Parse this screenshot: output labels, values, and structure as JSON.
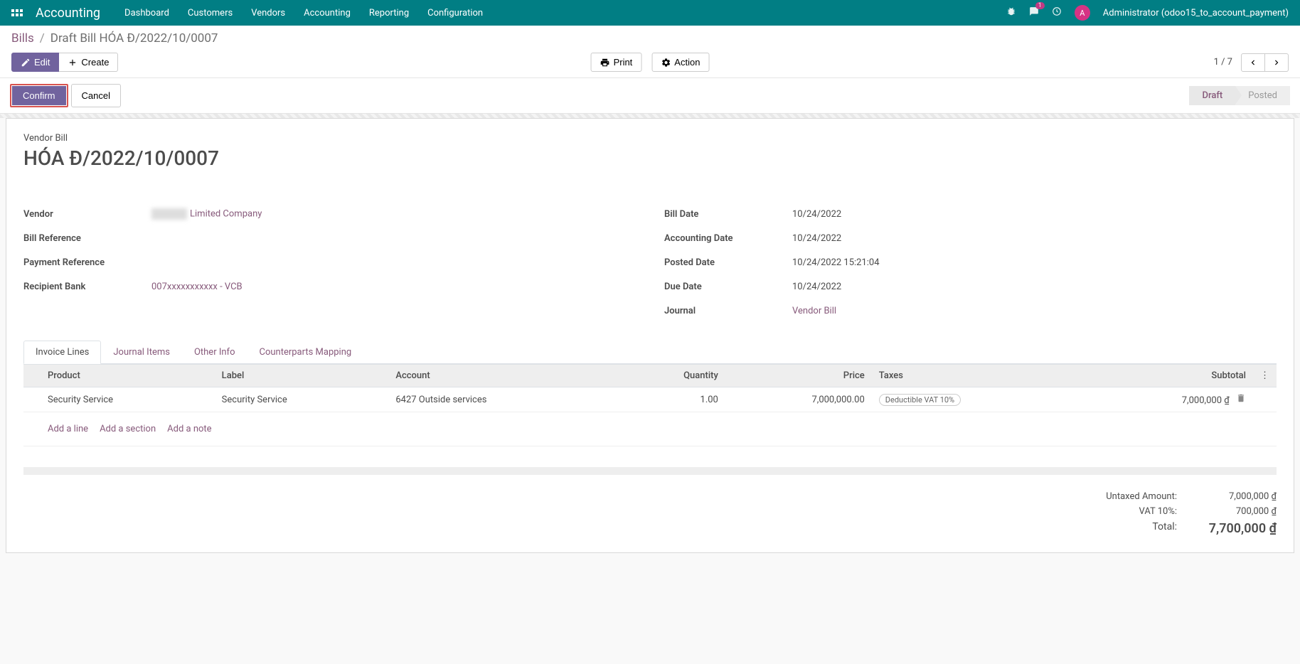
{
  "navbar": {
    "brand": "Accounting",
    "menu": [
      "Dashboard",
      "Customers",
      "Vendors",
      "Accounting",
      "Reporting",
      "Configuration"
    ],
    "chat_badge": "1",
    "user": {
      "initial": "A",
      "name": "Administrator (odoo15_to_account_payment)"
    }
  },
  "breadcrumb": {
    "root": "Bills",
    "current": "Draft Bill HÓA Đ/2022/10/0007"
  },
  "toolbar": {
    "edit": "Edit",
    "create": "Create",
    "print": "Print",
    "action": "Action",
    "pager": "1 / 7"
  },
  "statusbar": {
    "confirm": "Confirm",
    "cancel": "Cancel",
    "steps": [
      {
        "label": "Draft",
        "active": true
      },
      {
        "label": "Posted",
        "active": false
      }
    ]
  },
  "header": {
    "type": "Vendor Bill",
    "title": "HÓA Đ/2022/10/0007"
  },
  "fields_left": {
    "vendor_label": "Vendor",
    "vendor_value": "Limited Company",
    "billref_label": "Bill Reference",
    "billref_value": "",
    "payref_label": "Payment Reference",
    "payref_value": "",
    "bank_label": "Recipient Bank",
    "bank_value": "007xxxxxxxxxxx - VCB"
  },
  "fields_right": {
    "billdate_label": "Bill Date",
    "billdate_value": "10/24/2022",
    "accdate_label": "Accounting Date",
    "accdate_value": "10/24/2022",
    "postdate_label": "Posted Date",
    "postdate_value": "10/24/2022 15:21:04",
    "duedate_label": "Due Date",
    "duedate_value": "10/24/2022",
    "journal_label": "Journal",
    "journal_value": "Vendor Bill"
  },
  "tabs": [
    "Invoice Lines",
    "Journal Items",
    "Other Info",
    "Counterparts Mapping"
  ],
  "table": {
    "headers": {
      "product": "Product",
      "label": "Label",
      "account": "Account",
      "quantity": "Quantity",
      "price": "Price",
      "taxes": "Taxes",
      "subtotal": "Subtotal"
    },
    "rows": [
      {
        "product": "Security Service",
        "label": "Security Service",
        "account": "6427 Outside services",
        "quantity": "1.00",
        "price": "7,000,000.00",
        "tax": "Deductible VAT 10%",
        "subtotal": "7,000,000 ₫"
      }
    ],
    "add_line": "Add a line",
    "add_section": "Add a section",
    "add_note": "Add a note"
  },
  "totals": {
    "untaxed_label": "Untaxed Amount:",
    "untaxed_value": "7,000,000 ₫",
    "vat_label": "VAT 10%:",
    "vat_value": "700,000 ₫",
    "total_label": "Total:",
    "total_value": "7,700,000 ₫"
  }
}
